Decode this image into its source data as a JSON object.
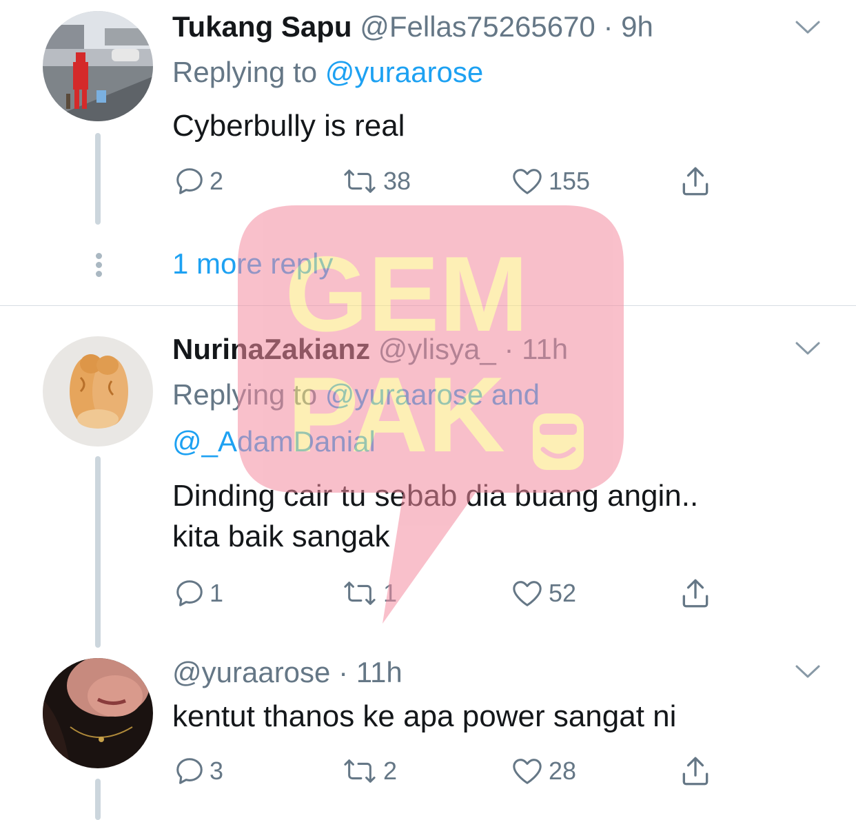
{
  "tweets": [
    {
      "name": "Tukang Sapu",
      "handle": "@Fellas75265670",
      "time": "9h",
      "replying_to_prefix": "Replying to",
      "replying_to_mention": "@yuraarose",
      "body": "Cyberbully is real",
      "replies": "2",
      "retweets": "38",
      "likes": "155",
      "avatar_icon": "photo-person-red-costume"
    },
    {
      "name": "NurinaZakianz",
      "handle": "@ylisya_",
      "time": "11h",
      "replying_to_prefix": "Replying to",
      "replying_to_mention": "@yuraarose",
      "replying_to_and": "and",
      "replying_to_mention2": "@_AdamDanial",
      "body_line1": "Dinding cair tu sebab dia buang angin..",
      "body_line2": "kita baik sangak",
      "replies": "1",
      "retweets": "1",
      "likes": "52",
      "avatar_icon": "photo-sleeping-cats"
    },
    {
      "handle": "@yuraarose",
      "time": "11h",
      "body": "kentut thanos ke apa power sangat ni",
      "replies": "3",
      "retweets": "2",
      "likes": "28",
      "avatar_icon": "photo-dark-portrait"
    }
  ],
  "more_reply": "1 more reply",
  "separator": "·",
  "watermark": {
    "line1": "GEM",
    "line2": "PAK",
    "bubble_color": "#f48ca0",
    "text_color": "#fde37a"
  },
  "colors": {
    "link": "#1da1f2",
    "secondary": "#657786",
    "primary_text": "#14171a",
    "thread_line": "#ccd6dd"
  }
}
